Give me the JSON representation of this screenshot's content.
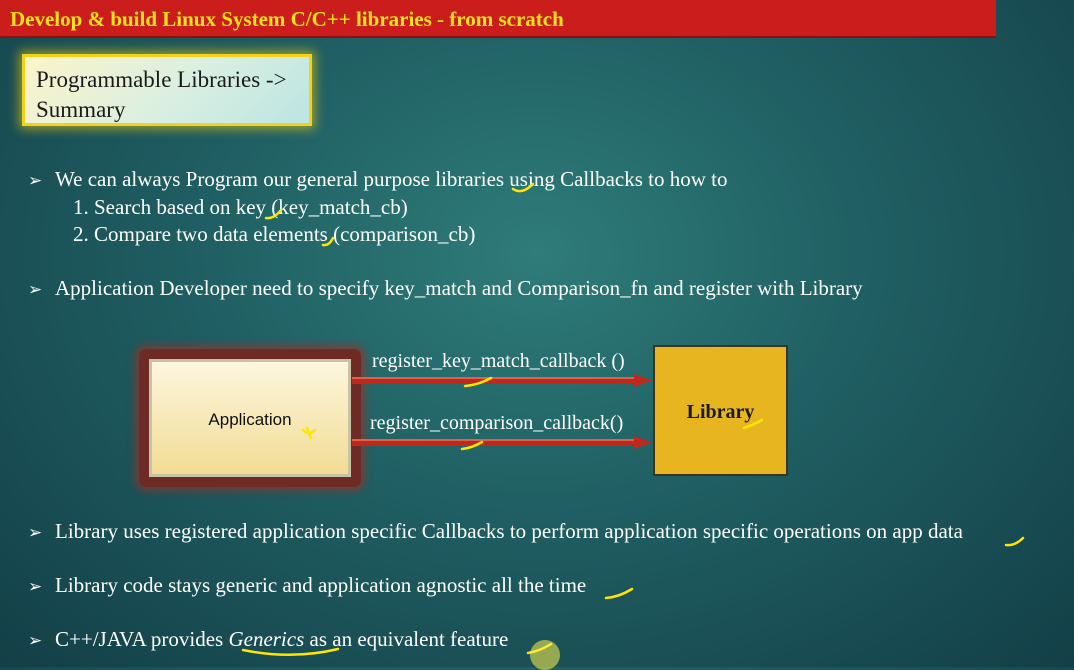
{
  "title_bar": {
    "title": "Develop & build Linux System C/C++ libraries - from scratch"
  },
  "summary_box": {
    "text": "Programmable Libraries ->\nSummary"
  },
  "bullets": {
    "b1": "We can always Program our general purpose libraries using Callbacks to how to",
    "b1_items": [
      "1. Search based on key (key_match_cb)",
      "2. Compare two data elements (comparison_cb)"
    ],
    "b2": "Application Developer need to specify key_match and Comparison_fn and register with Library",
    "b3": "Library uses registered application specific Callbacks to perform application specific operations on app data",
    "b4": "Library code stays generic and application agnostic all the time",
    "b5_prefix": "C++/JAVA provides ",
    "b5_emph": "Generics",
    "b5_suffix": " as an equivalent feature"
  },
  "diagram": {
    "application_label": "Application",
    "library_label": "Library",
    "arrow1_label": "register_key_match_callback ()",
    "arrow2_label": "register_comparison_callback()"
  },
  "icons": {
    "bullet": "arrowhead-bullet-icon",
    "arrow": "right-arrow-icon",
    "annotation": "yellow-pen-stroke"
  },
  "colors": {
    "title_bar_bg": "#cc1d1d",
    "title_text": "#ffe21a",
    "background": "#1f5e62",
    "library_fill": "#e6b51f",
    "arrow": "#c0281d",
    "annotation": "#ffe600"
  }
}
